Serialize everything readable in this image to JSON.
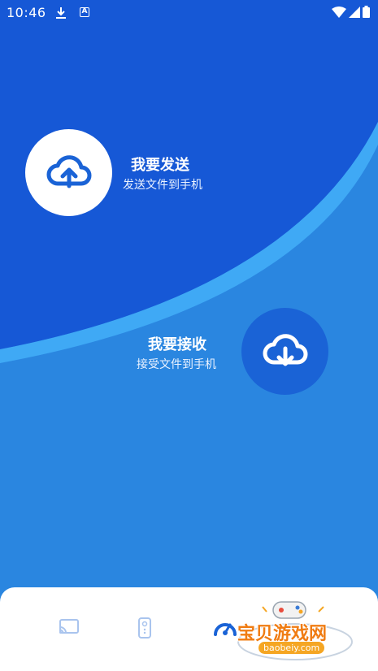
{
  "status_bar": {
    "time": "10:46",
    "icons": [
      "download-icon",
      "a-icon",
      "wifi-icon",
      "signal-icon",
      "battery-icon"
    ]
  },
  "send": {
    "title": "我要发送",
    "subtitle": "发送文件到手机",
    "icon": "cloud-upload-icon"
  },
  "receive": {
    "title": "我要接收",
    "subtitle": "接受文件到手机",
    "icon": "cloud-download-icon"
  },
  "bottom_nav": {
    "items": [
      "cast-icon",
      "remote-icon",
      "speedometer-icon"
    ]
  },
  "watermark": {
    "text": "宝贝游戏网",
    "url": "baobeiy.com"
  },
  "colors": {
    "top_blue": "#1658d6",
    "bottom_blue": "#2a86e0",
    "stripe": "#3fa9f5",
    "white": "#ffffff"
  }
}
